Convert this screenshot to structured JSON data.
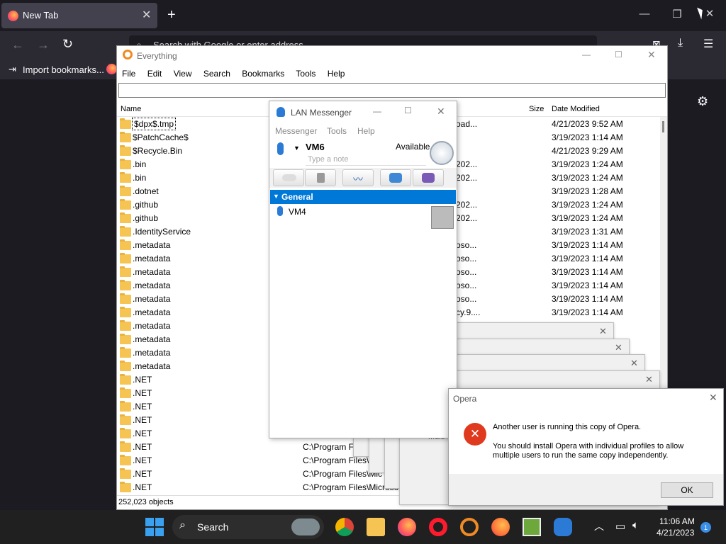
{
  "firefox": {
    "tab_title": "New Tab",
    "url_placeholder": "Search with Google or enter address",
    "bookmark_import": "Import bookmarks..."
  },
  "everything": {
    "title": "Everything",
    "menu": [
      "File",
      "Edit",
      "View",
      "Search",
      "Bookmarks",
      "Tools",
      "Help"
    ],
    "columns": {
      "name": "Name",
      "size": "Size",
      "date": "Date Modified"
    },
    "rows": [
      {
        "name": "$dpx$.tmp",
        "path": "oad...",
        "date": "4/21/2023 9:52 AM"
      },
      {
        "name": "$PatchCache$",
        "path": "",
        "date": "3/19/2023 1:14 AM"
      },
      {
        "name": "$Recycle.Bin",
        "path": "",
        "date": "4/21/2023 9:29 AM"
      },
      {
        "name": ".bin",
        "path": "202...",
        "date": "3/19/2023 1:24 AM"
      },
      {
        "name": ".bin",
        "path": "202...",
        "date": "3/19/2023 1:24 AM"
      },
      {
        "name": ".dotnet",
        "path": "",
        "date": "3/19/2023 1:28 AM"
      },
      {
        "name": ".github",
        "path": "202...",
        "date": "3/19/2023 1:24 AM"
      },
      {
        "name": ".github",
        "path": "202...",
        "date": "3/19/2023 1:24 AM"
      },
      {
        "name": ".IdentityService",
        "path": "",
        "date": "3/19/2023 1:31 AM"
      },
      {
        "name": ".metadata",
        "path": "oso...",
        "date": "3/19/2023 1:14 AM"
      },
      {
        "name": ".metadata",
        "path": "oso...",
        "date": "3/19/2023 1:14 AM"
      },
      {
        "name": ".metadata",
        "path": "oso...",
        "date": "3/19/2023 1:14 AM"
      },
      {
        "name": ".metadata",
        "path": "oso...",
        "date": "3/19/2023 1:14 AM"
      },
      {
        "name": ".metadata",
        "path": "oso...",
        "date": "3/19/2023 1:14 AM"
      },
      {
        "name": ".metadata",
        "path": "cy.9....",
        "date": "3/19/2023 1:14 AM"
      },
      {
        "name": ".metadata",
        "path": "",
        "date": ""
      },
      {
        "name": ".metadata",
        "path": "",
        "date": ""
      },
      {
        "name": ".metadata",
        "path": "",
        "date": ""
      },
      {
        "name": ".metadata",
        "path": "",
        "date": ""
      },
      {
        "name": ".NET",
        "path": "",
        "date": ""
      },
      {
        "name": ".NET",
        "path": "",
        "date": ""
      },
      {
        "name": ".NET",
        "path": "",
        "date": ""
      },
      {
        "name": ".NET",
        "path": "",
        "date": ""
      },
      {
        "name": ".NET",
        "path": "",
        "date": ""
      },
      {
        "name": ".NET",
        "path": "C:\\Program F",
        "date": ""
      },
      {
        "name": ".NET",
        "path": "C:\\Program Files\\",
        "date": ""
      },
      {
        "name": ".NET",
        "path": "C:\\Program Files\\Mic",
        "date": ""
      },
      {
        "name": ".NET",
        "path": "C:\\Program Files\\Microsoft Visual Stu",
        "date": ""
      }
    ],
    "status": "252,023 objects"
  },
  "lan": {
    "title": "LAN Messenger",
    "menu": [
      "Messenger",
      "Tools",
      "Help"
    ],
    "user": "VM6",
    "status": "Available",
    "note_placeholder": "Type a note",
    "group": "General",
    "contacts": [
      "VM4"
    ]
  },
  "opera": {
    "title": "Opera",
    "line1": "Another user is running this copy of Opera.",
    "line2": "You should install Opera with individual profiles to allow multiple users to run the same copy independently.",
    "ok": "OK",
    "behind_text": "Multi"
  },
  "taskbar": {
    "search": "Search",
    "time": "11:06 AM",
    "date": "4/21/2023",
    "badge": "1"
  },
  "colors": {
    "accent": "#0078d7",
    "error": "#e03a1e",
    "folder": "#f6c453"
  }
}
